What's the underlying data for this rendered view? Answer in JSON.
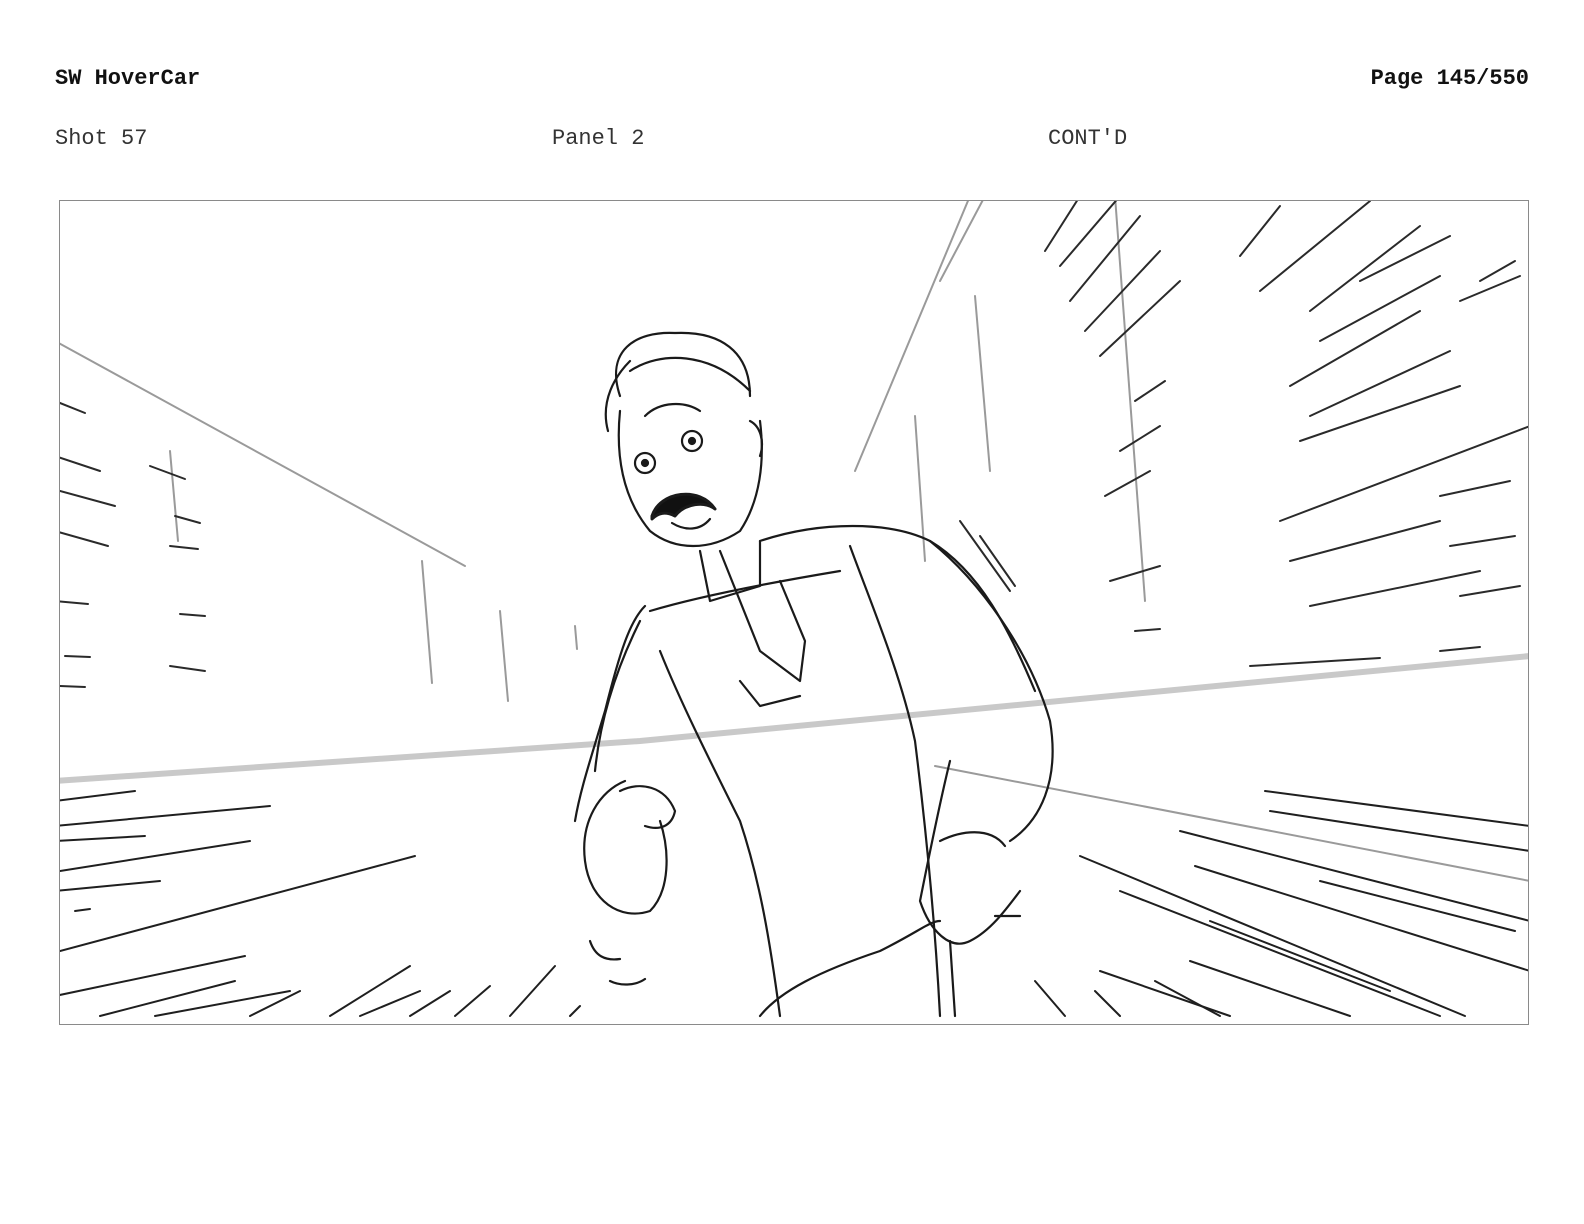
{
  "header": {
    "title": "SW HoverCar",
    "page": "Page 145/550"
  },
  "shot_info": {
    "shot": "Shot 57",
    "panel": "Panel 2",
    "continuation": "CONT'D"
  },
  "drawing": {
    "icon": "storyboard-sketch-icon",
    "subject": "man-with-mustache-running",
    "line_color": "#1a1a1a",
    "horizon_color": "#c8c8c8"
  }
}
